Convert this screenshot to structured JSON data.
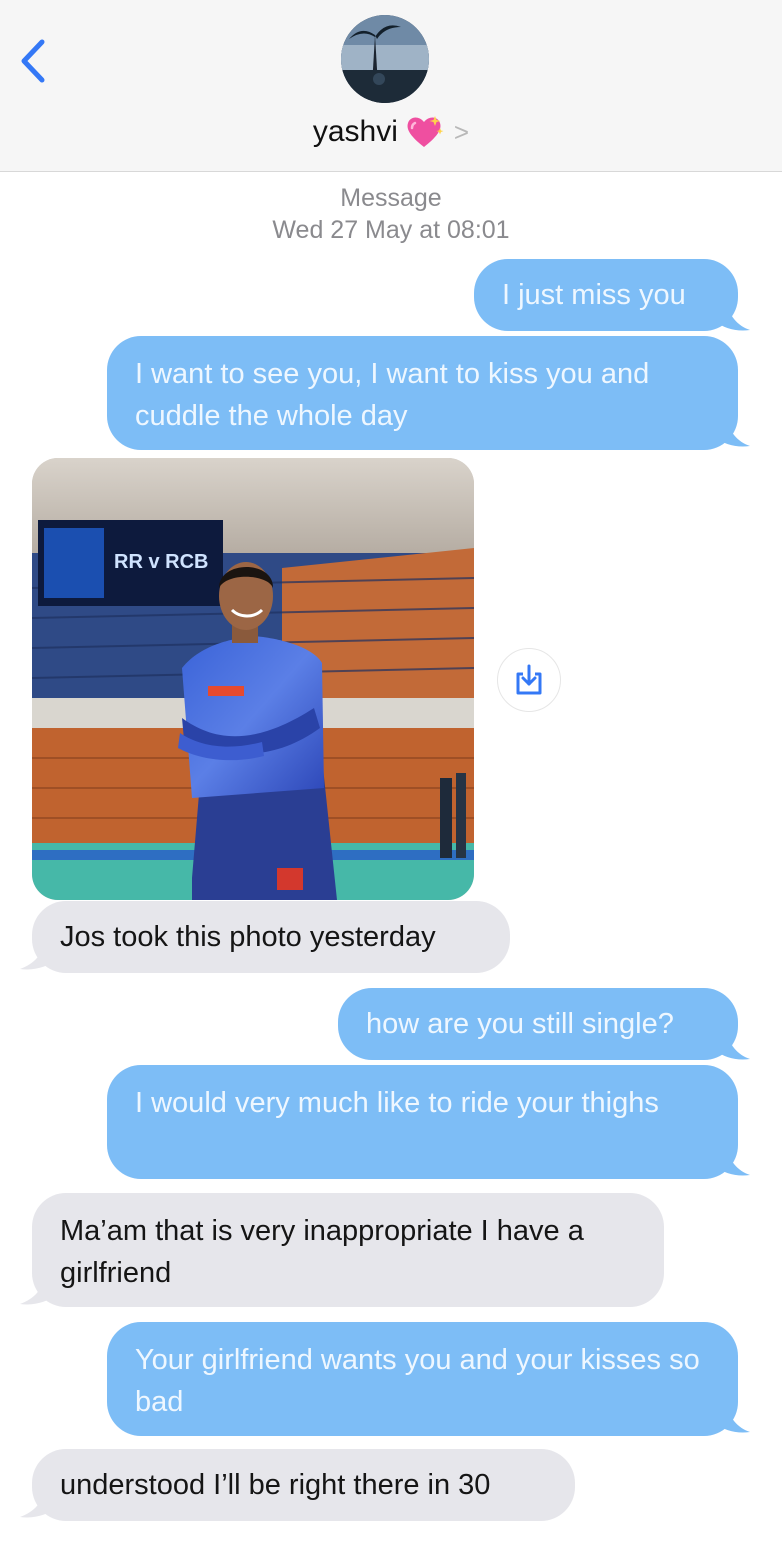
{
  "header": {
    "contact_name": "yashvi",
    "back_icon": "chevron-left-icon",
    "heart_icon": "sparkling-heart-icon",
    "disclosure_icon": "chevron-right-icon",
    "chevron_glyph": ">"
  },
  "meta": {
    "service": "Message",
    "timestamp": "Wed 27 May at 08:01"
  },
  "messages": [
    {
      "side": "sent",
      "text": "I just miss you"
    },
    {
      "side": "sent",
      "text": "I want to see you, I want to kiss you and cuddle the whole day"
    },
    {
      "side": "received",
      "type": "photo",
      "caption": "photo of cricketer in blue jersey in stadium"
    },
    {
      "side": "received",
      "text": "Jos took this photo yesterday"
    },
    {
      "side": "sent",
      "text": "how are you still single?"
    },
    {
      "side": "sent",
      "text": "I would very much like to ride your thighs"
    },
    {
      "side": "received",
      "text": "Ma’am that is very inappropriate I have a girlfriend"
    },
    {
      "side": "sent",
      "text": "Your girlfriend wants you and your kisses so bad"
    },
    {
      "side": "received",
      "text": "understood I’ll be right there in 30"
    }
  ],
  "photo": {
    "scoreboard_text": "RR v RCB",
    "save_icon": "save-download-icon"
  },
  "colors": {
    "sent_bubble": "#7dbdf6",
    "received_bubble": "#e6e6eb",
    "accent": "#3478f6"
  }
}
